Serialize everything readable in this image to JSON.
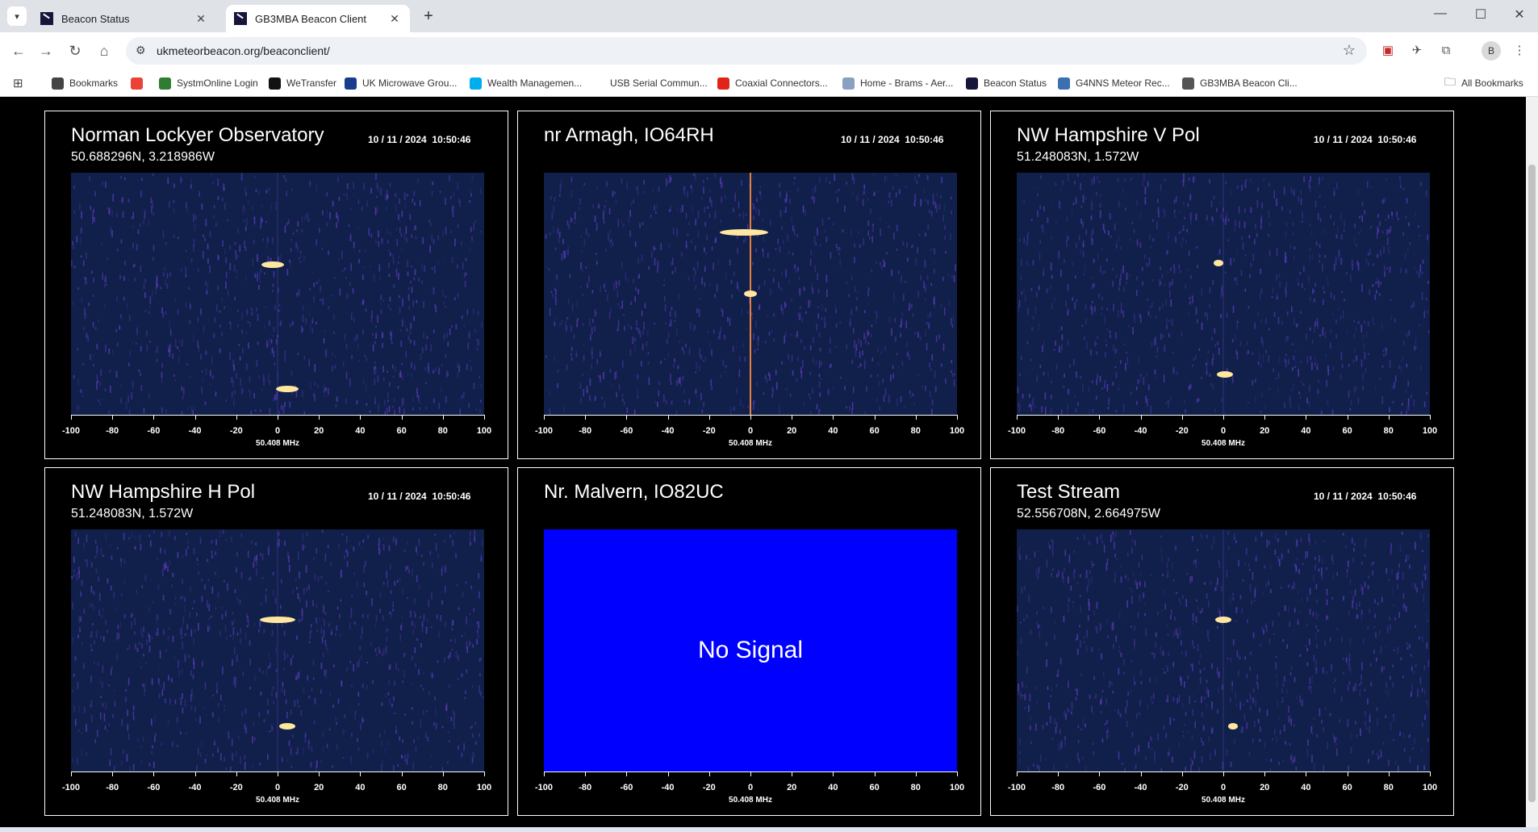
{
  "browser": {
    "tabs": [
      {
        "title": "Beacon Status",
        "active": false
      },
      {
        "title": "GB3MBA Beacon Client",
        "active": true
      }
    ],
    "url": "ukmeteorbeacon.org/beaconclient/",
    "bookmarks": [
      {
        "label": "Bookmarks",
        "icon": "star-icon",
        "color": "#444444"
      },
      {
        "label": "",
        "icon": "google-photos-icon",
        "color": "#ea4335"
      },
      {
        "label": "SystmOnline Login",
        "icon": "systm-icon",
        "color": "#2e7d32"
      },
      {
        "label": "WeTransfer",
        "icon": "wetransfer-icon",
        "color": "#111111"
      },
      {
        "label": "UK Microwave Grou...",
        "icon": "ukug-icon",
        "color": "#1a3c8f"
      },
      {
        "label": "Wealth Managemen...",
        "icon": "barclays-icon",
        "color": "#00aeef"
      },
      {
        "label": "USB Serial Commun...",
        "icon": "blank-icon",
        "color": "#ffffff"
      },
      {
        "label": "Coaxial Connectors...",
        "icon": "rs-icon",
        "color": "#e2231a"
      },
      {
        "label": "Home - Brams - Aer...",
        "icon": "brams-icon",
        "color": "#8aa0c0"
      },
      {
        "label": "Beacon Status",
        "icon": "beacon-icon",
        "color": "#16163a"
      },
      {
        "label": "G4NNS Meteor Rec...",
        "icon": "g4nns-icon",
        "color": "#3a6fb0"
      },
      {
        "label": "GB3MBA Beacon Cli...",
        "icon": "globe-icon",
        "color": "#555555"
      }
    ],
    "all_bookmarks": "All Bookmarks",
    "avatar_letter": "B"
  },
  "axis": {
    "ticks": [
      -100,
      -80,
      -60,
      -40,
      -20,
      0,
      20,
      40,
      60,
      80,
      100
    ],
    "title": "50.408 MHz"
  },
  "panels": [
    {
      "title": "Norman Lockyer Observatory",
      "coords": "50.688296N, 3.218986W",
      "date": "10 / 11 / 2024  10:50:46",
      "signal": true
    },
    {
      "title": "nr Armagh, IO64RH",
      "coords": "",
      "date": "10 / 11 / 2024  10:50:46",
      "signal": true
    },
    {
      "title": "NW Hampshire V Pol",
      "coords": "51.248083N, 1.572W",
      "date": "10 / 11 / 2024  10:50:46",
      "signal": true
    },
    {
      "title": "NW Hampshire H Pol",
      "coords": "51.248083N, 1.572W",
      "date": "10 / 11 / 2024  10:50:46",
      "signal": true
    },
    {
      "title": "Nr. Malvern, IO82UC",
      "coords": "",
      "date": "",
      "signal": false,
      "nosignal_text": "No Signal"
    },
    {
      "title": "Test Stream",
      "coords": "52.556708N, 2.664975W",
      "date": "10 / 11 / 2024  10:50:46",
      "signal": true
    }
  ],
  "colors": {
    "waterfall_bg": "#10204a",
    "waterfall_noise": "#6a3fd0",
    "nosignal_bg": "#0000ff",
    "echo": "#ffe7a0"
  }
}
